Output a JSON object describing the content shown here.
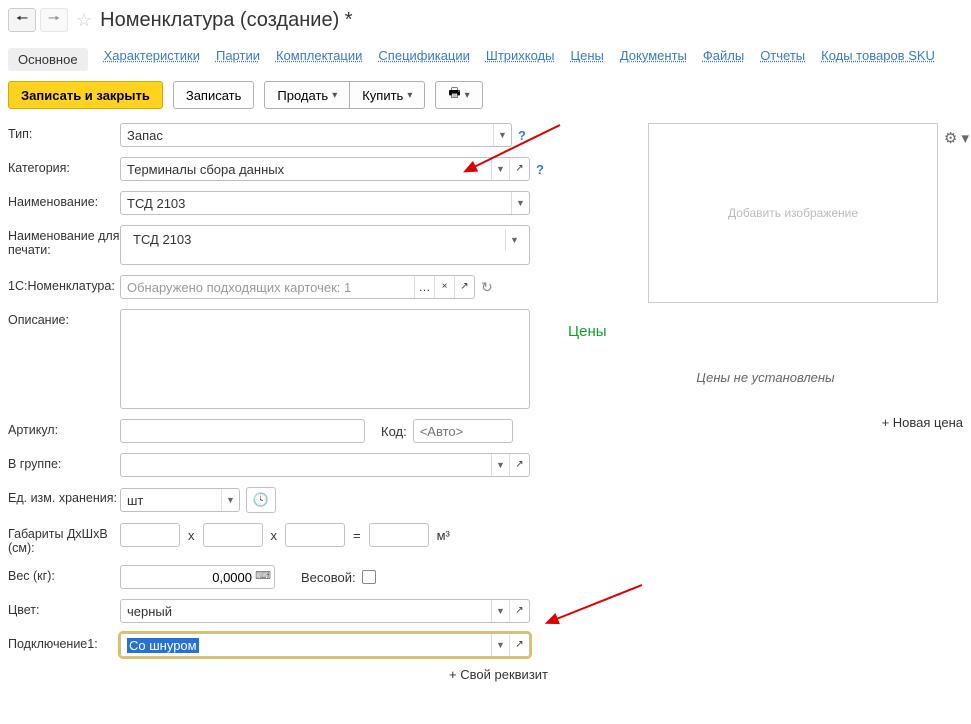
{
  "header": {
    "title": "Номенклатура (создание) *"
  },
  "tabs": {
    "items": [
      {
        "label": "Основное",
        "active": true
      },
      {
        "label": "Характеристики"
      },
      {
        "label": "Партии"
      },
      {
        "label": "Комплектации"
      },
      {
        "label": "Спецификации"
      },
      {
        "label": "Штрихкоды"
      },
      {
        "label": "Цены"
      },
      {
        "label": "Документы"
      },
      {
        "label": "Файлы"
      },
      {
        "label": "Отчеты"
      },
      {
        "label": "Коды товаров SKU"
      }
    ]
  },
  "actions": {
    "save_close": "Записать и закрыть",
    "save": "Записать",
    "sell": "Продать",
    "buy": "Купить"
  },
  "form": {
    "type_label": "Тип:",
    "type_value": "Запас",
    "category_label": "Категория:",
    "category_value": "Терминалы сбора данных",
    "name_label": "Наименование:",
    "name_value": "ТСД 2103",
    "print_name_label": "Наименование для печати:",
    "print_name_value": "ТСД 2103",
    "nomen_label": "1С:Номенклатура:",
    "nomen_placeholder": "Обнаружено подходящих карточек: 1",
    "desc_label": "Описание:",
    "article_label": "Артикул:",
    "code_label": "Код:",
    "code_placeholder": "<Авто>",
    "group_label": "В группе:",
    "unit_label": "Ед. изм. хранения:",
    "unit_value": "шт",
    "dims_label": "Габариты ДхШхВ (см):",
    "dims_x": "х",
    "dims_eq": "=",
    "dims_unit": "м³",
    "weight_label": "Вес (кг):",
    "weight_value": "0,0000",
    "weight_flag_label": "Весовой:",
    "color_label": "Цвет:",
    "color_value": "черный",
    "conn_label": "Подключение1:",
    "conn_value": "Со шнуром",
    "own_req": "+ Свой реквизит"
  },
  "right": {
    "image_placeholder": "Добавить изображение",
    "prices_title": "Цены",
    "prices_empty": "Цены не установлены",
    "new_price": "+ Новая цена"
  }
}
